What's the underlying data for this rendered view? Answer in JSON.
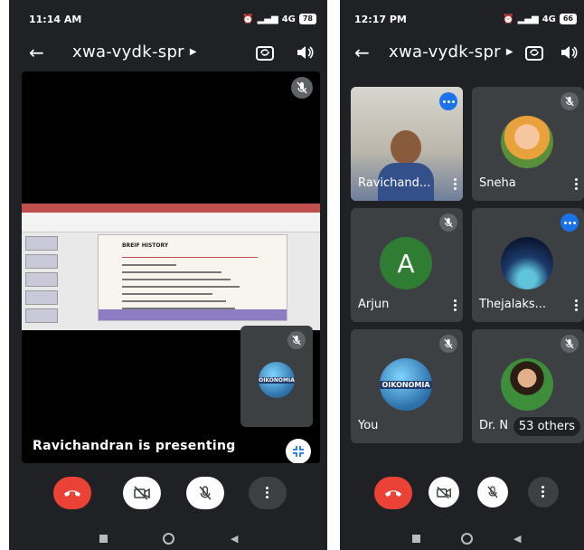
{
  "left": {
    "status": {
      "time": "11:14 AM",
      "signal": "4G",
      "battery": "78"
    },
    "meeting_code": "xwa-vydk-spr",
    "presenting_text": "Ravichandran is presenting",
    "slide": {
      "heading": "BREIF HISTORY"
    }
  },
  "right": {
    "status": {
      "time": "12:17 PM",
      "signal": "4G",
      "battery": "66"
    },
    "meeting_code": "xwa-vydk-spr",
    "participants": [
      {
        "name": "Ravichand...",
        "mic": "speaking"
      },
      {
        "name": "Sneha",
        "mic": "muted"
      },
      {
        "name": "Arjun",
        "mic": "muted",
        "initial": "A"
      },
      {
        "name": "Thejalaks...",
        "mic": "speaking"
      },
      {
        "name": "You",
        "mic": "muted"
      },
      {
        "name": "Dr. N",
        "mic": "muted"
      }
    ],
    "others_label": "53 others"
  },
  "colors": {
    "bg": "#202124",
    "tile": "#3c4043",
    "end_call": "#ea4335",
    "speaking": "#1a73e8",
    "avatar_a": "#2e7d32"
  },
  "icons": [
    "back-arrow-icon",
    "camera-flip-icon",
    "speaker-icon",
    "mic-off-icon",
    "end-call-icon",
    "camera-off-icon",
    "more-vert-icon",
    "collapse-icon"
  ]
}
